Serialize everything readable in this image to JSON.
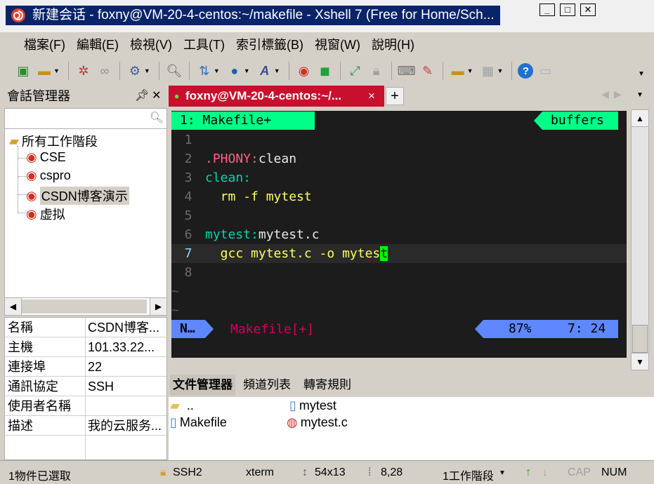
{
  "window": {
    "title": "新建会话 - foxny@VM-20-4-centos:~/makefile - Xshell 7 (Free for Home/Sch..."
  },
  "menu": [
    "檔案(F)",
    "編輯(E)",
    "檢視(V)",
    "工具(T)",
    "索引標籤(B)",
    "視窗(W)",
    "說明(H)"
  ],
  "session_panel": {
    "title": "會話管理器",
    "search_placeholder": "",
    "root": "所有工作階段",
    "items": [
      "CSE",
      "cspro",
      "CSDN博客演示",
      "虚拟"
    ],
    "selected": "CSDN博客演示"
  },
  "properties": [
    {
      "key": "名稱",
      "value": "CSDN博客..."
    },
    {
      "key": "主機",
      "value": "101.33.22..."
    },
    {
      "key": "連接埠",
      "value": "22"
    },
    {
      "key": "通訊協定",
      "value": "SSH"
    },
    {
      "key": "使用者名稱",
      "value": ""
    },
    {
      "key": "描述",
      "value": "我的云服务..."
    }
  ],
  "tabs": {
    "active_label": "foxny@VM-20-4-centos:~/...",
    "close": "×",
    "add": "+"
  },
  "terminal": {
    "buffer_label": "1: Makefile+",
    "buffers_label": "buffers",
    "lines": [
      {
        "num": "1",
        "parts": []
      },
      {
        "num": "2",
        "parts": [
          {
            "t": ".PHONY:",
            "c": "#ff5f87"
          },
          {
            "t": "clean",
            "c": "#e8e8e8"
          }
        ]
      },
      {
        "num": "3",
        "parts": [
          {
            "t": "clean:",
            "c": "#00d7af"
          }
        ]
      },
      {
        "num": "4",
        "parts": [
          {
            "t": "  rm -f mytest",
            "c": "#ffff5f"
          }
        ]
      },
      {
        "num": "5",
        "parts": []
      },
      {
        "num": "6",
        "parts": [
          {
            "t": "mytest:",
            "c": "#00d7af"
          },
          {
            "t": "mytest.c",
            "c": "#e8e8e8"
          }
        ]
      },
      {
        "num": "7",
        "parts": [
          {
            "t": "  gcc mytest.c -o mytes",
            "c": "#ffff5f"
          },
          {
            "t": "t",
            "c": "#000000",
            "bg": "#00ff00"
          }
        ]
      },
      {
        "num": "8",
        "parts": []
      }
    ],
    "tildes": [
      "~",
      "~"
    ],
    "mode": "N…",
    "file": "Makefile[+]",
    "percent": "87%",
    "position": "7: 24",
    "current_line": "7"
  },
  "file_manager": {
    "tabs": [
      "文件管理器",
      "頻道列表",
      "轉寄規則"
    ],
    "items": [
      "..",
      "mytest",
      "Makefile",
      "mytest.c"
    ]
  },
  "status": {
    "selected": "1物件已選取",
    "protocol": "SSH2",
    "term": "xterm",
    "size": "54x13",
    "cursor": "8,28",
    "sessions": "1工作階段",
    "cap": "CAP",
    "num": "NUM"
  },
  "colors": {
    "title_bg": "#0a246a",
    "tab_active": "#c8102e",
    "terminal_bg": "#1c1c1c",
    "airline_green": "#00ff87",
    "airline_blue": "#5f87ff"
  }
}
